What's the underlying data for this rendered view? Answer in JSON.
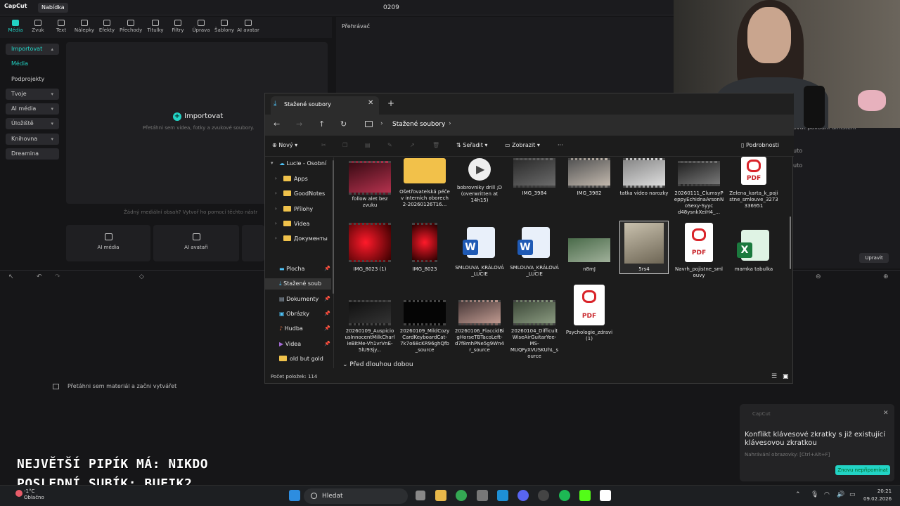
{
  "capcut": {
    "app_name": "CapCut",
    "menu": "Nabídka",
    "project_name": "0209",
    "tools": [
      "Média",
      "Zvuk",
      "Text",
      "Nálepky",
      "Efekty",
      "Přechody",
      "Titulky",
      "Filtry",
      "Úprava",
      "Šablony",
      "AI avatar"
    ],
    "left_nav": {
      "import": "Importovat",
      "media": "Média",
      "subprojects": "Podprojekty",
      "yours": "Tvoje",
      "ai_media": "AI média",
      "storage": "Úložiště",
      "library": "Knihovna",
      "dreamina": "Dreamina"
    },
    "import_button": "Importovat",
    "import_hint": "Přetáhni sem videa, fotky a zvukové soubory.",
    "empty_text": "Žádný mediální obsah? Vytvoř ho pomocí těchto nástr",
    "ai_cards": [
      "AI média",
      "AI avataři"
    ],
    "player_title": "Přehrávač",
    "timeline_hint": "Přetáhni sem materiál a začni vytvářet",
    "right_panel": {
      "line1": "ovat povodni umisteni",
      "line2": "uto",
      "line3": "uto",
      "edit_button": "Upravit"
    }
  },
  "explorer": {
    "tab_title": "Stažené soubory",
    "breadcrumb": "Stažené soubory",
    "commands": {
      "new": "Nový",
      "sort": "Seřadit",
      "view": "Zobrazit",
      "more": "···",
      "details": "Podrobnosti"
    },
    "tree": {
      "root": "Lucie - Osobní",
      "items": [
        "Apps",
        "GoodNotes",
        "Přílohy",
        "Videa",
        "Документы"
      ],
      "quick_access": [
        "Plocha",
        "Stažené soub",
        "Dokumenty",
        "Obrázky",
        "Hudba",
        "Videa",
        "old but gold"
      ]
    },
    "files": [
      {
        "name": "follow alet bez zvuku",
        "kind": "video"
      },
      {
        "name": "Ošetřovatelská péče v interních oborech 2-20260126T16...",
        "kind": "zip"
      },
      {
        "name": "bobrovniky drill ;D (overwritten at 14h15)",
        "kind": "audio"
      },
      {
        "name": "IMG_3984",
        "kind": "video"
      },
      {
        "name": "IMG_3982",
        "kind": "video"
      },
      {
        "name": "tatka video narozky",
        "kind": "video"
      },
      {
        "name": "20260111_ClumsyPeppyEchidnaArsonNoSexy-Syyc d48ysnkXeiH4_...",
        "kind": "video"
      },
      {
        "name": "Zelena_karta_k_pojistne_smlouve_3273336951",
        "kind": "pdf"
      },
      {
        "name": "IMG_8023 (1)",
        "kind": "video"
      },
      {
        "name": "IMG_8023",
        "kind": "video"
      },
      {
        "name": "SMLOUVA_KRÁLOVÁ_LUCIE",
        "kind": "word"
      },
      {
        "name": "SMLOUVA_KRÁLOVÁ_LUCIE",
        "kind": "word"
      },
      {
        "name": "n8mJ",
        "kind": "image"
      },
      {
        "name": "5rs4",
        "kind": "image"
      },
      {
        "name": "Navrh_pojistne_smlouvy",
        "kind": "pdf"
      },
      {
        "name": "mamka tabulka",
        "kind": "excel"
      },
      {
        "name": "20260109_AuspiciousInnocentMilkCharlieBitMe-Vh1vrVnE-5lU93jy...",
        "kind": "video"
      },
      {
        "name": "20260109_MildCozyCardKeyboardCat-7k7o68cKR96ghQfb_source",
        "kind": "video"
      },
      {
        "name": "20260106_FlaccidBigHorseTBTacoLeft-d7f8mhPNe5g9Wn4r_source",
        "kind": "video"
      },
      {
        "name": "20260104_DifficultWiseAirGuitarYee-MS-MUQFyXVUSKUhL_source",
        "kind": "video"
      },
      {
        "name": "Psychologie_zdravi (1)",
        "kind": "pdf"
      }
    ],
    "pdf_label": "PDF",
    "group_header": "Před dlouhou dobou",
    "status": "Počet položek: 114"
  },
  "toast": {
    "app": "CapCut",
    "title": "Konflikt klávesové zkratky s již existující klávesovou zkratkou",
    "subtitle": "Nahrávání obrazovky: [Ctrl+Alt+F]",
    "button": "Znovu nepřipomínat"
  },
  "overlay": {
    "line1": "NEJVĚTŠÍ PIPÍK MÁ: NIKDO",
    "line2": "POSLEDNÍ SUBÍK: BUFIK2"
  },
  "taskbar": {
    "temp": "-1°C",
    "weather": "Oblačno",
    "search": "Hledat",
    "time": "20:21",
    "date": "09.02.2026"
  },
  "colors": {
    "accent": "#22d3c5",
    "pdf_red": "#d9242a"
  }
}
